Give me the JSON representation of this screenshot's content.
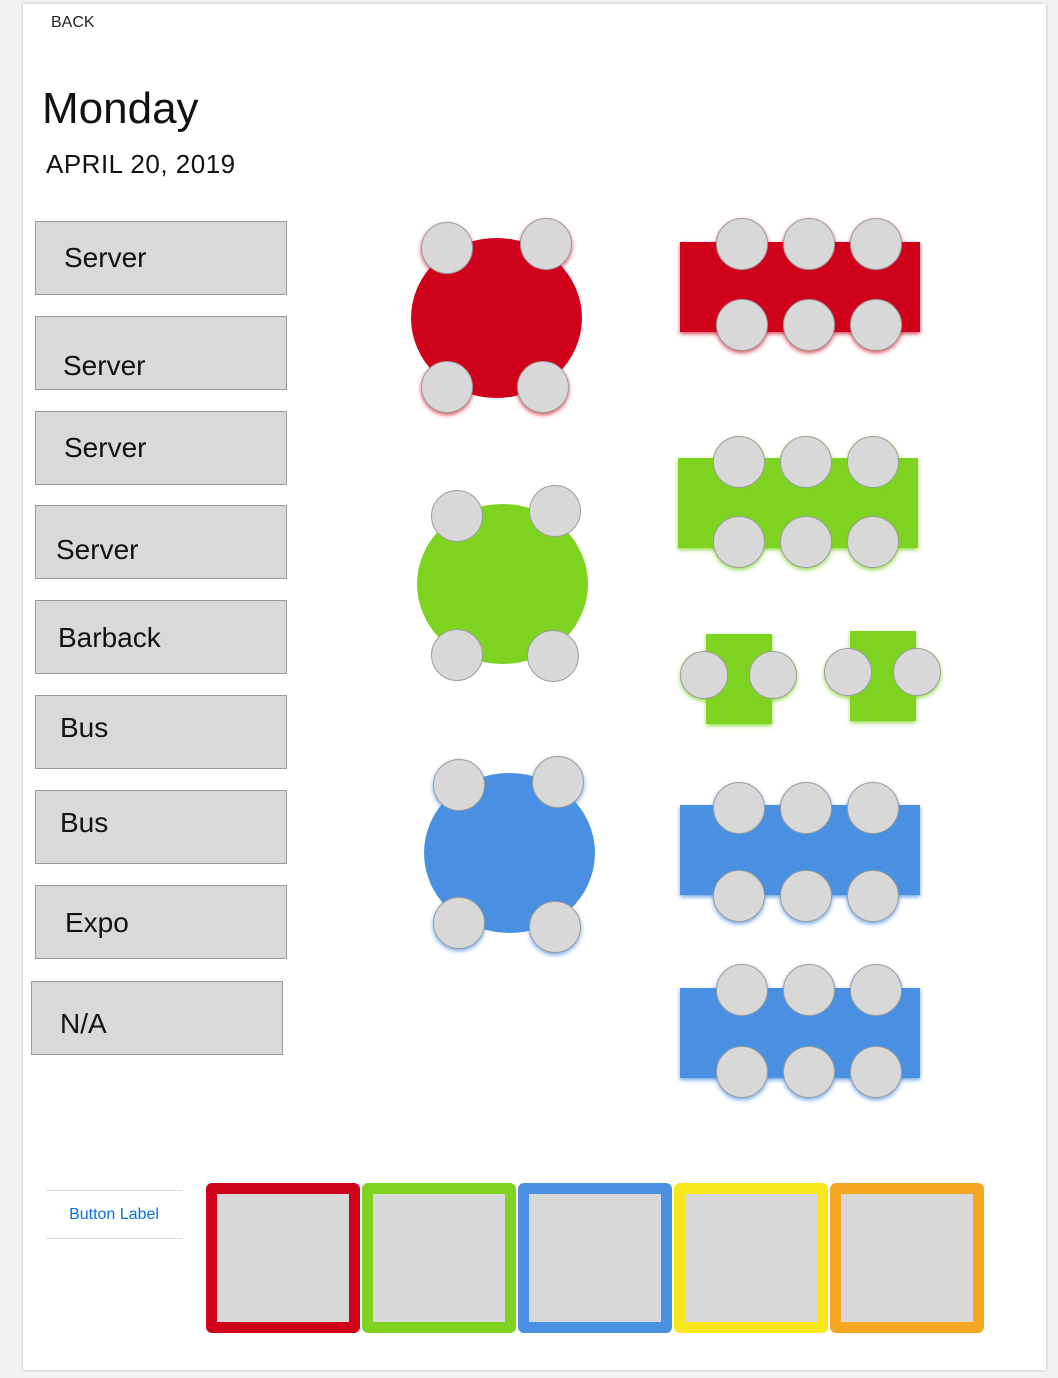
{
  "header": {
    "back_label": "BACK",
    "day": "Monday",
    "date": "APRIL 20, 2019"
  },
  "roles": [
    "Server",
    "Server",
    "Server",
    "Server",
    "Barback",
    "Bus",
    "Bus",
    "Expo",
    "N/A"
  ],
  "floor": {
    "tables": [
      {
        "shape": "round",
        "color": "red",
        "seats": 4
      },
      {
        "shape": "rectangle",
        "color": "red",
        "seats": 6
      },
      {
        "shape": "round",
        "color": "green",
        "seats": 4
      },
      {
        "shape": "rectangle",
        "color": "green",
        "seats": 6
      },
      {
        "shape": "square",
        "color": "green",
        "seats": 2
      },
      {
        "shape": "square",
        "color": "green",
        "seats": 2
      },
      {
        "shape": "round",
        "color": "blue",
        "seats": 4
      },
      {
        "shape": "rectangle",
        "color": "blue",
        "seats": 6
      },
      {
        "shape": "rectangle",
        "color": "blue",
        "seats": 6
      }
    ]
  },
  "footer": {
    "button_label": "Button Label",
    "swatches": [
      {
        "name": "red",
        "color": "#d0021b"
      },
      {
        "name": "green",
        "color": "#7ed321"
      },
      {
        "name": "blue",
        "color": "#4a90e2"
      },
      {
        "name": "yellow",
        "color": "#f8e71c"
      },
      {
        "name": "orange",
        "color": "#f5a623"
      }
    ]
  }
}
